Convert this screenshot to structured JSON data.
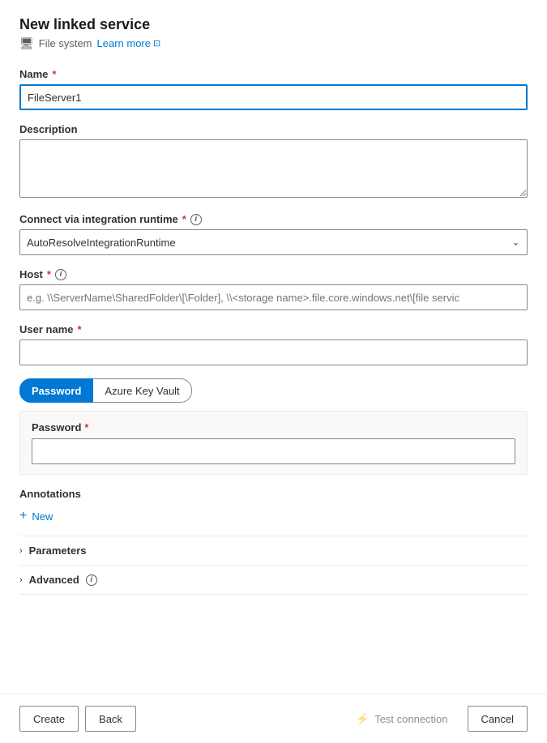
{
  "page": {
    "title": "New linked service",
    "subtitle": "File system",
    "learn_more_label": "Learn more",
    "external_link_icon": "↗"
  },
  "form": {
    "name_label": "Name",
    "name_value": "FileServer1",
    "name_placeholder": "",
    "description_label": "Description",
    "description_placeholder": "",
    "integration_runtime_label": "Connect via integration runtime",
    "integration_runtime_value": "AutoResolveIntegrationRuntime",
    "integration_runtime_options": [
      "AutoResolveIntegrationRuntime"
    ],
    "host_label": "Host",
    "host_placeholder": "e.g. \\\\ServerName\\SharedFolder\\[\\Folder], \\\\<storage name>.file.core.windows.net\\[file servic",
    "username_label": "User name",
    "username_placeholder": "",
    "password_tab_label": "Password",
    "azure_key_vault_tab_label": "Azure Key Vault",
    "password_inner_label": "Password",
    "password_placeholder": "",
    "annotations_label": "Annotations",
    "new_annotation_label": "New",
    "parameters_label": "Parameters",
    "advanced_label": "Advanced"
  },
  "footer": {
    "create_label": "Create",
    "back_label": "Back",
    "test_connection_label": "Test connection",
    "cancel_label": "Cancel"
  },
  "icons": {
    "file_system": "🖥",
    "info": "i",
    "chevron_down": "⌄",
    "chevron_right": "›",
    "plus": "+",
    "test_conn": "⚡"
  }
}
